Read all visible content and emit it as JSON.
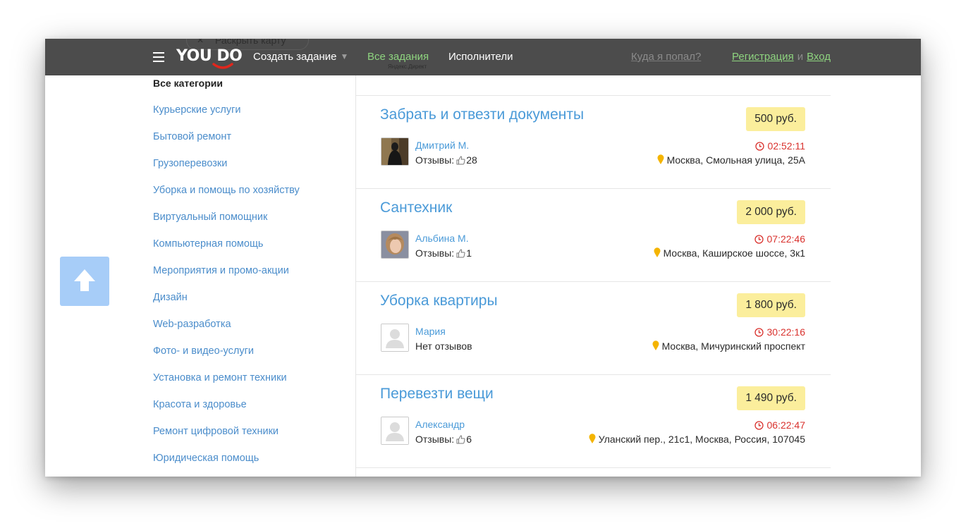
{
  "header": {
    "ghost_button": "Раскрыть карту",
    "logo": "YOU DO",
    "create_task": "Создать задание",
    "all_tasks": "Все задания",
    "ad_label": "Яндекс.Директ",
    "performers": "Исполнители",
    "where_am_i": "Куда я попал?",
    "register": "Регистрация",
    "and": "и",
    "login": "Вход"
  },
  "sidebar": {
    "title": "Все категории",
    "items": [
      {
        "label": "Курьерские услуги"
      },
      {
        "label": "Бытовой ремонт"
      },
      {
        "label": "Грузоперевозки"
      },
      {
        "label": "Уборка и помощь по хозяйству"
      },
      {
        "label": "Виртуальный помощник"
      },
      {
        "label": "Компьютерная помощь"
      },
      {
        "label": "Мероприятия и промо-акции"
      },
      {
        "label": "Дизайн"
      },
      {
        "label": "Web-разработка"
      },
      {
        "label": "Фото- и видео-услуги"
      },
      {
        "label": "Установка и ремонт техники"
      },
      {
        "label": "Красота и здоровье"
      },
      {
        "label": "Ремонт цифровой техники"
      },
      {
        "label": "Юридическая помощь"
      }
    ]
  },
  "tasks": [
    {
      "title": "Забрать и отвезти документы",
      "price": "500 руб.",
      "author": "Дмитрий М.",
      "reviews_label": "Отзывы:",
      "reviews_count": "28",
      "time": "02:52:11",
      "address": "Москва, Смольная улица, 25А"
    },
    {
      "title": "Сантехник",
      "price": "2 000 руб.",
      "author": "Альбина М.",
      "reviews_label": "Отзывы:",
      "reviews_count": "1",
      "time": "07:22:46",
      "address": "Москва, Каширское шоссе, 3к1"
    },
    {
      "title": "Уборка квартиры",
      "price": "1 800 руб.",
      "author": "Мария",
      "reviews_label": "Нет отзывов",
      "time": "30:22:16",
      "address": "Москва, Мичуринский проспект"
    },
    {
      "title": "Перевезти вещи",
      "price": "1 490 руб.",
      "author": "Александр",
      "reviews_label": "Отзывы:",
      "reviews_count": "6",
      "time": "06:22:47",
      "address": "Уланский пер., 21с1, Москва, Россия, 107045"
    }
  ],
  "colors": {
    "header_bg": "#4c4c4c",
    "accent_green": "#8ed47f",
    "link_blue": "#4a9ad8",
    "price_bg": "#fbee9c",
    "timer_red": "#d9322e",
    "scroll_button": "#a7cdf8"
  },
  "icons": [
    "menu-icon",
    "chevron-down-icon",
    "thumb-up-icon",
    "clock-icon",
    "map-pin-icon",
    "arrow-up-icon",
    "user-placeholder-icon"
  ]
}
